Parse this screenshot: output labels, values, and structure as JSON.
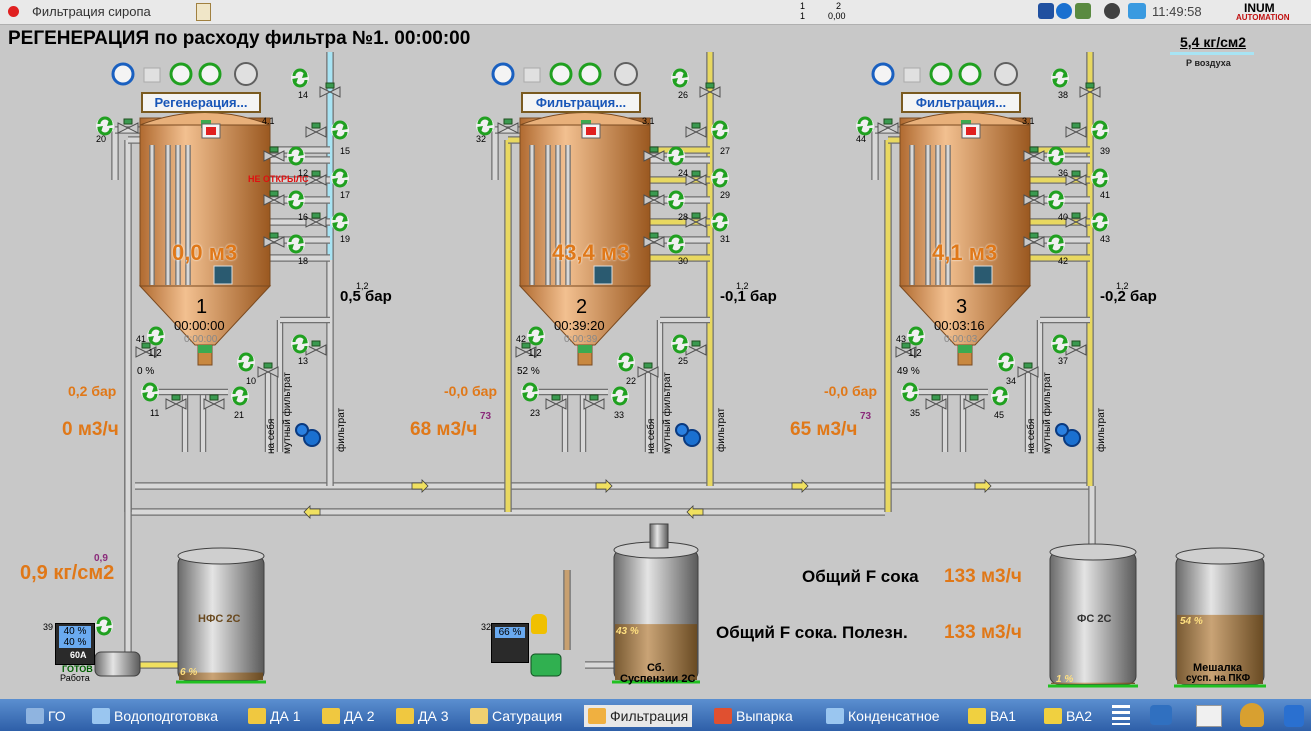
{
  "window": {
    "title": "Фильтрация сиропа",
    "counter_top": "1",
    "counter_bottom": "1",
    "counter2_top": "2",
    "counter2_bottom": "0,00",
    "clock": "11:49:58",
    "logo_line1": "INUM",
    "logo_line2": "AUTOMATION"
  },
  "header": {
    "title": "РЕГЕНЕРАЦИЯ по расходу фильтра №1.  00:00:00",
    "air_pressure": "5,4 кг/см2",
    "air_label": "Р воздуха"
  },
  "filters": [
    {
      "number": "1",
      "mode": "Регенерация...",
      "volume": "0,0 м3",
      "timer": "00:00:00",
      "timer2": "0:00:00",
      "pressure_out": "0,5 бар",
      "pressure_in": "0,2 бар",
      "flow": "0 м3/ч",
      "valve_pos": "0 %",
      "pressure_tag": "1,2",
      "alarm": "НЕ ОТКРЫЛС",
      "flow_tag": "",
      "level_label": "4.1",
      "valves": [
        "14",
        "20",
        "15",
        "12",
        "17",
        "16",
        "19",
        "18",
        "41",
        "13",
        "10",
        "11",
        "21"
      ]
    },
    {
      "number": "2",
      "mode": "Фильтрация...",
      "volume": "43,4 м3",
      "timer": "00:39:20",
      "timer2": "0:00:39",
      "pressure_out": "-0,1 бар",
      "pressure_in": "-0,0 бар",
      "flow": "68 м3/ч",
      "valve_pos": "52 %",
      "pressure_tag": "1,2",
      "alarm": "",
      "flow_tag": "73",
      "level_label": "3.1",
      "valves": [
        "26",
        "32",
        "27",
        "24",
        "29",
        "28",
        "31",
        "30",
        "42",
        "25",
        "22",
        "23",
        "33"
      ]
    },
    {
      "number": "3",
      "mode": "Фильтрация...",
      "volume": "4,1 м3",
      "timer": "00:03:16",
      "timer2": "0:00:03",
      "pressure_out": "-0,2 бар",
      "pressure_in": "-0,0 бар",
      "flow": "65 м3/ч",
      "valve_pos": "49 %",
      "pressure_tag": "1,2",
      "alarm": "",
      "flow_tag": "73",
      "level_label": "3.1",
      "valves": [
        "38",
        "44",
        "39",
        "36",
        "41",
        "40",
        "43",
        "42",
        "43",
        "37",
        "34",
        "35",
        "45"
      ]
    }
  ],
  "side_labels": {
    "self": "на себя",
    "turbid": "мутный фильтрат",
    "filtrate": "фильтрат",
    "half": "1|2"
  },
  "pump": {
    "pressure": "0,9 кг/см2",
    "pressure_tag": "0,9",
    "panel_num": "39",
    "panel_v1": "40 %",
    "panel_v2": "40 %",
    "panel_amp": "60A",
    "status1": "ГОТОВ",
    "status2": "Работа"
  },
  "tanks": {
    "nfs": {
      "label": "НФС 2С",
      "level": "6 %"
    },
    "suspension": {
      "label1": "Сб.",
      "label2": "Суспензии 2С",
      "level": "43 %",
      "panel_num": "32",
      "panel_val": "66 %"
    },
    "fs": {
      "label": "ФС 2С",
      "level": "1 %"
    },
    "mixer": {
      "label1": "Мешалка",
      "label2": "сусп. на ПКФ",
      "level": "54 %"
    }
  },
  "totals": {
    "label1": "Общий F сока",
    "value1": "133 м3/ч",
    "label2": "Общий F сока. Полезн.",
    "value2": "133 м3/ч"
  },
  "taskbar": [
    {
      "label": "ГО",
      "color": "#8fb4e0"
    },
    {
      "label": "Водоподготовка",
      "color": "#9ac6f0"
    },
    {
      "label": "ДА 1",
      "color": "#f0c840"
    },
    {
      "label": "ДА 2",
      "color": "#f0c840"
    },
    {
      "label": "ДА 3",
      "color": "#f0c840"
    },
    {
      "label": "Сатурация",
      "color": "#f0d070"
    },
    {
      "label": "Фильтрация",
      "color": "#f0b040"
    },
    {
      "label": "Выпарка",
      "color": "#e05030"
    },
    {
      "label": "Конденсатное",
      "color": "#9ac6f0"
    },
    {
      "label": "ВА1",
      "color": "#f0d040"
    },
    {
      "label": "ВА2",
      "color": "#f0d040"
    }
  ],
  "colors": {
    "tank_copper": "#d99a55",
    "pipe_yellow": "#e8d860",
    "pipe_cyan": "#a8e4f4",
    "value_orange": "#e07818"
  }
}
